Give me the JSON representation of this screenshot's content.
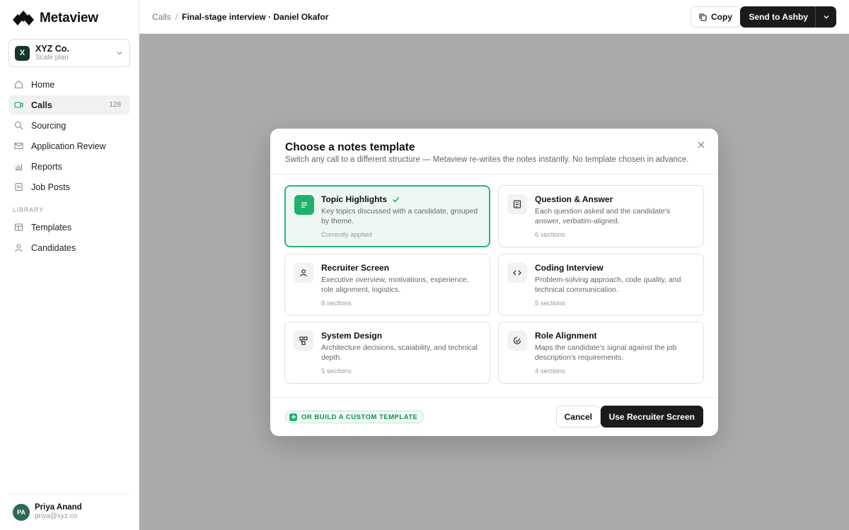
{
  "app": {
    "name": "Metaview"
  },
  "org": {
    "name": "XYZ Co.",
    "plan": "Scale plan",
    "badge": "X"
  },
  "nav": [
    {
      "label": "Home",
      "icon": "home-icon"
    },
    {
      "label": "Calls",
      "icon": "video-icon",
      "count": "128",
      "active": true
    },
    {
      "label": "Sourcing",
      "icon": "search-icon"
    },
    {
      "label": "Application Review",
      "icon": "mail-icon"
    },
    {
      "label": "Reports",
      "icon": "chart-icon"
    },
    {
      "label": "Job Posts",
      "icon": "document-icon"
    }
  ],
  "library": {
    "label": "LIBRARY",
    "items": [
      {
        "label": "Templates",
        "icon": "template-icon"
      },
      {
        "label": "Candidates",
        "icon": "person-icon"
      }
    ]
  },
  "user": {
    "name": "Priya Anand",
    "email": "priya@xyz.co",
    "initials": "PA"
  },
  "breadcrumb": {
    "parent": "Calls",
    "separator": "/",
    "current": "Final-stage interview · Daniel Okafor"
  },
  "toolbar": {
    "copy_label": "Copy",
    "send_label": "Send to Ashby"
  },
  "modal": {
    "title": "Choose a notes template",
    "subtitle": "Switch any call to a different structure — Metaview re-writes the notes instantly. No template chosen in advance.",
    "templates": [
      {
        "title": "Topic Highlights",
        "desc": "Key topics discussed with a candidate, grouped by theme.",
        "meta": "Currently applied",
        "icon": "list-icon",
        "selected": true
      },
      {
        "title": "Question & Answer",
        "desc": "Each question asked and the candidate's answer, verbatim-aligned.",
        "meta": "6 sections",
        "icon": "notes-icon"
      },
      {
        "title": "Recruiter Screen",
        "desc": "Executive overview, motivations, experience, role alignment, logistics.",
        "meta": "8 sections",
        "icon": "person-icon"
      },
      {
        "title": "Coding Interview",
        "desc": "Problem-solving approach, code quality, and technical communication.",
        "meta": "5 sections",
        "icon": "code-icon"
      },
      {
        "title": "System Design",
        "desc": "Architecture decisions, scalability, and technical depth.",
        "meta": "5 sections",
        "icon": "diagram-icon"
      },
      {
        "title": "Role Alignment",
        "desc": "Maps the candidate's signal against the job description's requirements.",
        "meta": "4 sections",
        "icon": "target-icon"
      }
    ],
    "custom_label": "OR BUILD A CUSTOM TEMPLATE",
    "cancel_label": "Cancel",
    "confirm_label": "Use Recruiter Screen"
  },
  "colors": {
    "accent": "#1fb06e",
    "primary_button": "#1b1b1b",
    "overlay": "#a9aaab"
  }
}
